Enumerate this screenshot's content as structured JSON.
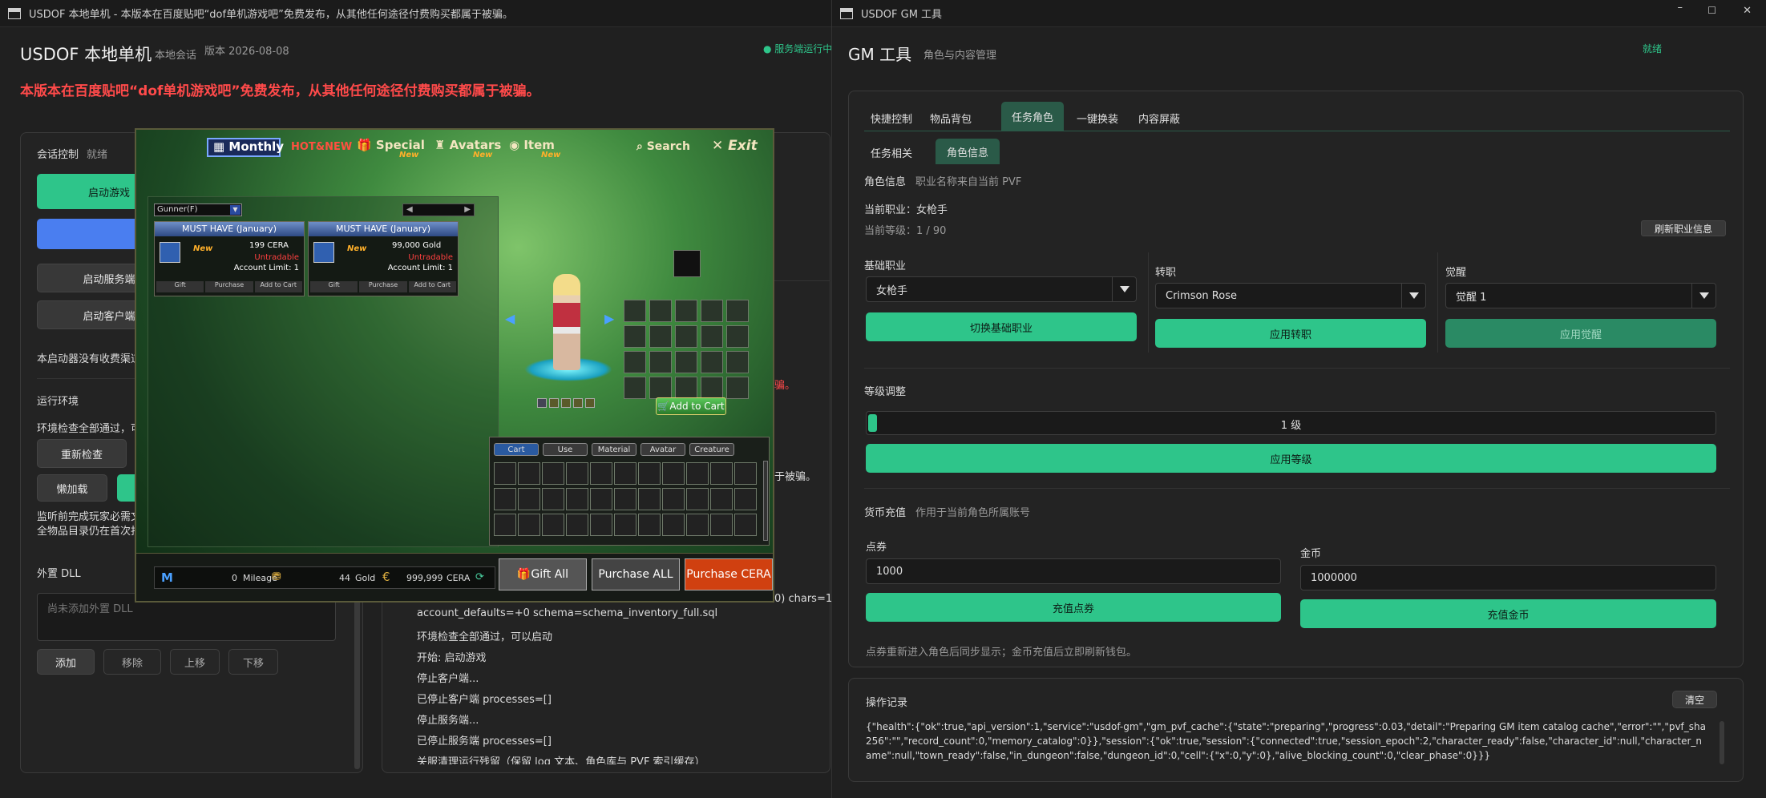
{
  "left": {
    "titlebar": "USDOF 本地单机 - 本版本在百度贴吧“dof单机游戏吧”免费发布，从其他任何途径付费购买都属于被骗。",
    "app_title": "USDOF 本地单机",
    "session_label": "本地会话",
    "version": "版本 2026-08-08",
    "service_status": "服务端运行中",
    "warning": "本版本在百度贴吧“dof单机游戏吧”免费发布，从其他任何途径付费购买都属于被骗。",
    "session_control": "会话控制",
    "ready": "就绪",
    "start_game": "启动游戏",
    "start_server": "启动服务端",
    "start_client": "启动客户端",
    "no_charge": "本启动器没有收费渠道",
    "runtime_env": "运行环境",
    "env_check_passed": "环境检查全部通过，可以启动",
    "recheck": "重新检查",
    "lazy_load": "懒加载",
    "monitor_note1": "监听前完成玩家必需文件",
    "monitor_note2": "全物品目录仍在首次打开",
    "external_dll": "外置 DLL",
    "dll_placeholder": "尚未添加外置 DLL",
    "add": "添加",
    "remove": "移除",
    "move_up": "上移",
    "move_down": "下移",
    "log_frag1": "于被骗。",
    "log_frag2": "0) chars=1",
    "log_red": "骗。",
    "log_lines": [
      "account_defaults=+0 schema=schema_inventory_full.sql",
      "环境检查全部通过，可以启动",
      "开始: 启动游戏",
      "停止客户端...",
      "已停止客户端 processes=[]",
      "停止服务端...",
      "已停止服务端 processes=[]",
      "关服清理运行残留（保留 log 文本、角色库与 PVF 索引缓存）"
    ]
  },
  "game": {
    "nav": [
      "Monthly",
      "HOT&NEW",
      "Special",
      "Avatars",
      "Item",
      "Search",
      "Exit"
    ],
    "new_badge": "New",
    "class_select": "Gunner(F)",
    "cards": [
      {
        "head": "MUST HAVE (January)",
        "new": "New",
        "price": "199",
        "currency": "CERA",
        "trade": "Untradable",
        "limit": "Account Limit: 1",
        "actions": [
          "Gift",
          "Purchase",
          "Add to Cart"
        ]
      },
      {
        "head": "MUST HAVE (January)",
        "new": "New",
        "price": "99,000",
        "currency": "Gold",
        "trade": "Untradable",
        "limit": "Account Limit: 1",
        "actions": [
          "Gift",
          "Purchase",
          "Add to Cart"
        ]
      }
    ],
    "add_to_cart": "Add to Cart",
    "cart_tabs": [
      "Cart",
      "Use",
      "Material",
      "Avatar",
      "Creature"
    ],
    "mileage_value": "0",
    "mileage_label": "Mileage",
    "gold_value": "44",
    "gold_label": "Gold",
    "cera_value": "999,999",
    "cera_label": "CERA",
    "gift_all": "Gift All",
    "purchase_all": "Purchase ALL",
    "purchase_cera": "Purchase CERA"
  },
  "right": {
    "titlebar": "USDOF GM 工具",
    "title": "GM 工具",
    "subtitle": "角色与内容管理",
    "status": "就绪",
    "tabs": [
      "快捷控制",
      "物品背包",
      "任务角色",
      "一键换装",
      "内容屏蔽"
    ],
    "subtabs": [
      "任务相关",
      "角色信息"
    ],
    "char_info": "角色信息",
    "char_info_note": "职业名称来自当前 PVF",
    "current_job": "当前职业：女枪手",
    "current_level": "当前等级：1 / 90",
    "refresh_job": "刷新职业信息",
    "base_job_label": "基础职业",
    "base_job_value": "女枪手",
    "switch_base": "切换基础职业",
    "advance_label": "转职",
    "advance_value": "Crimson Rose",
    "apply_advance": "应用转职",
    "awaken_label": "觉醒",
    "awaken_value": "觉醒 1",
    "apply_awaken": "应用觉醒",
    "level_adjust": "等级调整",
    "level_value": "1 级",
    "level_fraction": 0.01,
    "apply_level": "应用等级",
    "currency_title": "货币充值",
    "currency_note": "作用于当前角色所属账号",
    "points_label": "点券",
    "points_value": "1000",
    "charge_points": "充值点券",
    "gold_label": "金币",
    "gold_value": "1000000",
    "charge_gold": "充值金币",
    "currency_hint": "点券重新进入角色后同步显示；金币充值后立即刷新钱包。",
    "oplog_title": "操作记录",
    "clear": "清空",
    "oplog_text": "{\"health\":{\"ok\":true,\"api_version\":1,\"service\":\"usdof-gm\",\"gm_pvf_cache\":{\"state\":\"preparing\",\"progress\":0.03,\"detail\":\"Preparing GM item catalog cache\",\"error\":\"\",\"pvf_sha256\":\"\",\"record_count\":0,\"memory_catalog\":0}},\"session\":{\"ok\":true,\"session\":{\"connected\":true,\"session_epoch\":2,\"character_ready\":false,\"character_id\":null,\"character_name\":null,\"town_ready\":false,\"in_dungeon\":false,\"dungeon_id\":0,\"cell\":{\"x\":0,\"y\":0},\"alive_blocking_count\":0,\"clear_phase\":0}}}"
  }
}
